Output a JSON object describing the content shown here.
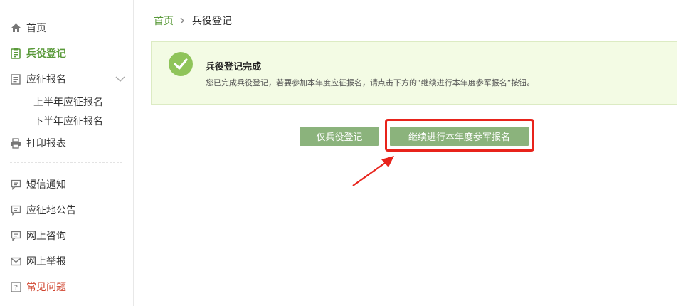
{
  "sidebar": {
    "items": [
      {
        "label": "首页",
        "icon": "home-icon"
      },
      {
        "label": "兵役登记",
        "icon": "clipboard-icon",
        "active": true
      },
      {
        "label": "应征报名",
        "icon": "form-icon",
        "expanded": true,
        "children": [
          {
            "label": "上半年应征报名"
          },
          {
            "label": "下半年应征报名"
          }
        ]
      },
      {
        "label": "打印报表",
        "icon": "printer-icon"
      },
      {
        "label": "短信通知",
        "icon": "message-icon"
      },
      {
        "label": "应征地公告",
        "icon": "message-icon"
      },
      {
        "label": "网上咨询",
        "icon": "message-icon"
      },
      {
        "label": "网上举报",
        "icon": "mail-icon"
      },
      {
        "label": "常见问题",
        "icon": "question-icon"
      }
    ]
  },
  "breadcrumb": {
    "home": "首页",
    "current": "兵役登记"
  },
  "notice": {
    "title": "兵役登记完成",
    "text": "您已完成兵役登记，若要参加本年度应征报名，请点击下方的“继续进行本年度参军报名”按钮。"
  },
  "actions": {
    "only_register": "仅兵役登记",
    "continue_enlist": "继续进行本年度参军报名"
  },
  "colors": {
    "accent_green": "#5a9a3a",
    "button_green": "#8bb37c",
    "notice_bg": "#f3fbe4",
    "highlight_red": "#e8231b",
    "danger_red": "#d0452f"
  }
}
